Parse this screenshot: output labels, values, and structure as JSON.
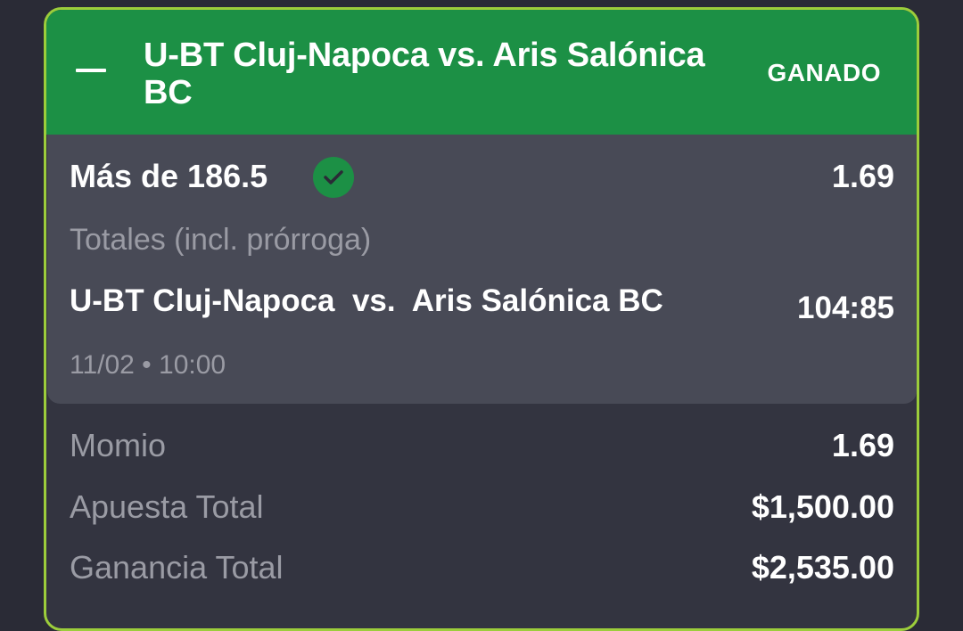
{
  "header": {
    "title": "U-BT Cluj-Napoca vs. Aris Salónica BC",
    "status": "GANADO"
  },
  "selection": {
    "name": "Más de 186.5",
    "odds": "1.69",
    "market": "Totales (incl. prórroga)",
    "event": "U-BT Cluj-Napoca  vs.  Aris Salónica BC",
    "score": "104:85",
    "datetime": "11/02 • 10:00"
  },
  "summary": {
    "odds_label": "Momio",
    "odds_value": "1.69",
    "stake_label": "Apuesta Total",
    "stake_value": "$1,500.00",
    "payout_label": "Ganancia Total",
    "payout_value": "$2,535.00"
  },
  "colors": {
    "background": "#2a2b36",
    "card": "#333440",
    "header_green": "#1c9045",
    "border_lime": "#9ccd3b",
    "selection_panel": "#484a56",
    "muted_text": "#9a9ba4"
  }
}
